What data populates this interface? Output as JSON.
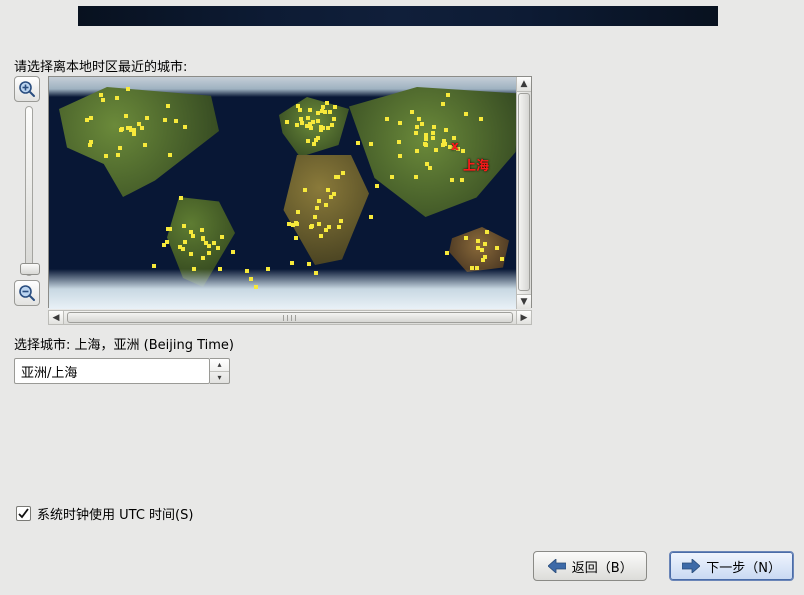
{
  "prompt_label": "请选择离本地时区最近的城市:",
  "map": {
    "marker_glyph": "x",
    "marker_city": "上海"
  },
  "selected_label": "选择城市: 上海，亚洲 (Beijing Time)",
  "timezone_select": {
    "value": "亚洲/上海"
  },
  "utc_checkbox": {
    "checked": true,
    "label": "系统时钟使用 UTC 时间(S)"
  },
  "buttons": {
    "back": "返回（B）",
    "next": "下一步（N）"
  }
}
